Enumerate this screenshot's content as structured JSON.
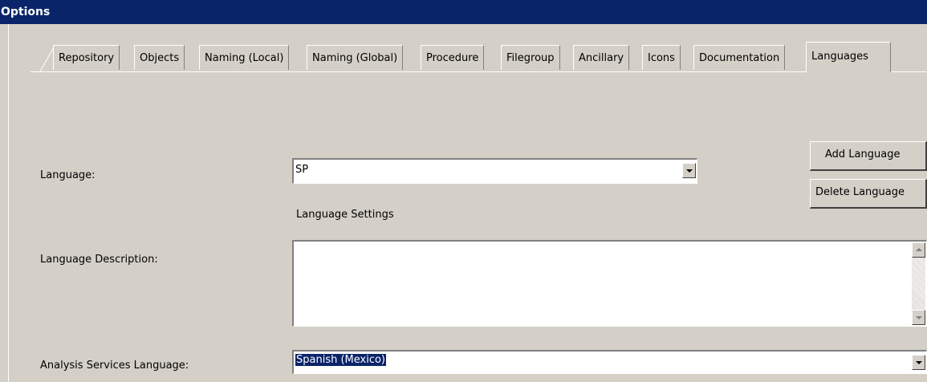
{
  "window": {
    "title": "Options"
  },
  "tabs": [
    {
      "label": "Repository"
    },
    {
      "label": "Objects"
    },
    {
      "label": "Naming (Local)"
    },
    {
      "label": "Naming (Global)"
    },
    {
      "label": "Procedure"
    },
    {
      "label": "Filegroup"
    },
    {
      "label": "Ancillary"
    },
    {
      "label": "Icons"
    },
    {
      "label": "Documentation"
    },
    {
      "label": "Languages",
      "active": true
    }
  ],
  "form": {
    "language_label": "Language:",
    "language_value": "SP",
    "settings_heading": "Language Settings",
    "description_label": "Language Description:",
    "description_value": "",
    "analysis_label": "Analysis Services Language:",
    "analysis_value": "Spanish (Mexico)"
  },
  "buttons": {
    "add_language": "Add Language",
    "delete_language": "Delete Language"
  }
}
